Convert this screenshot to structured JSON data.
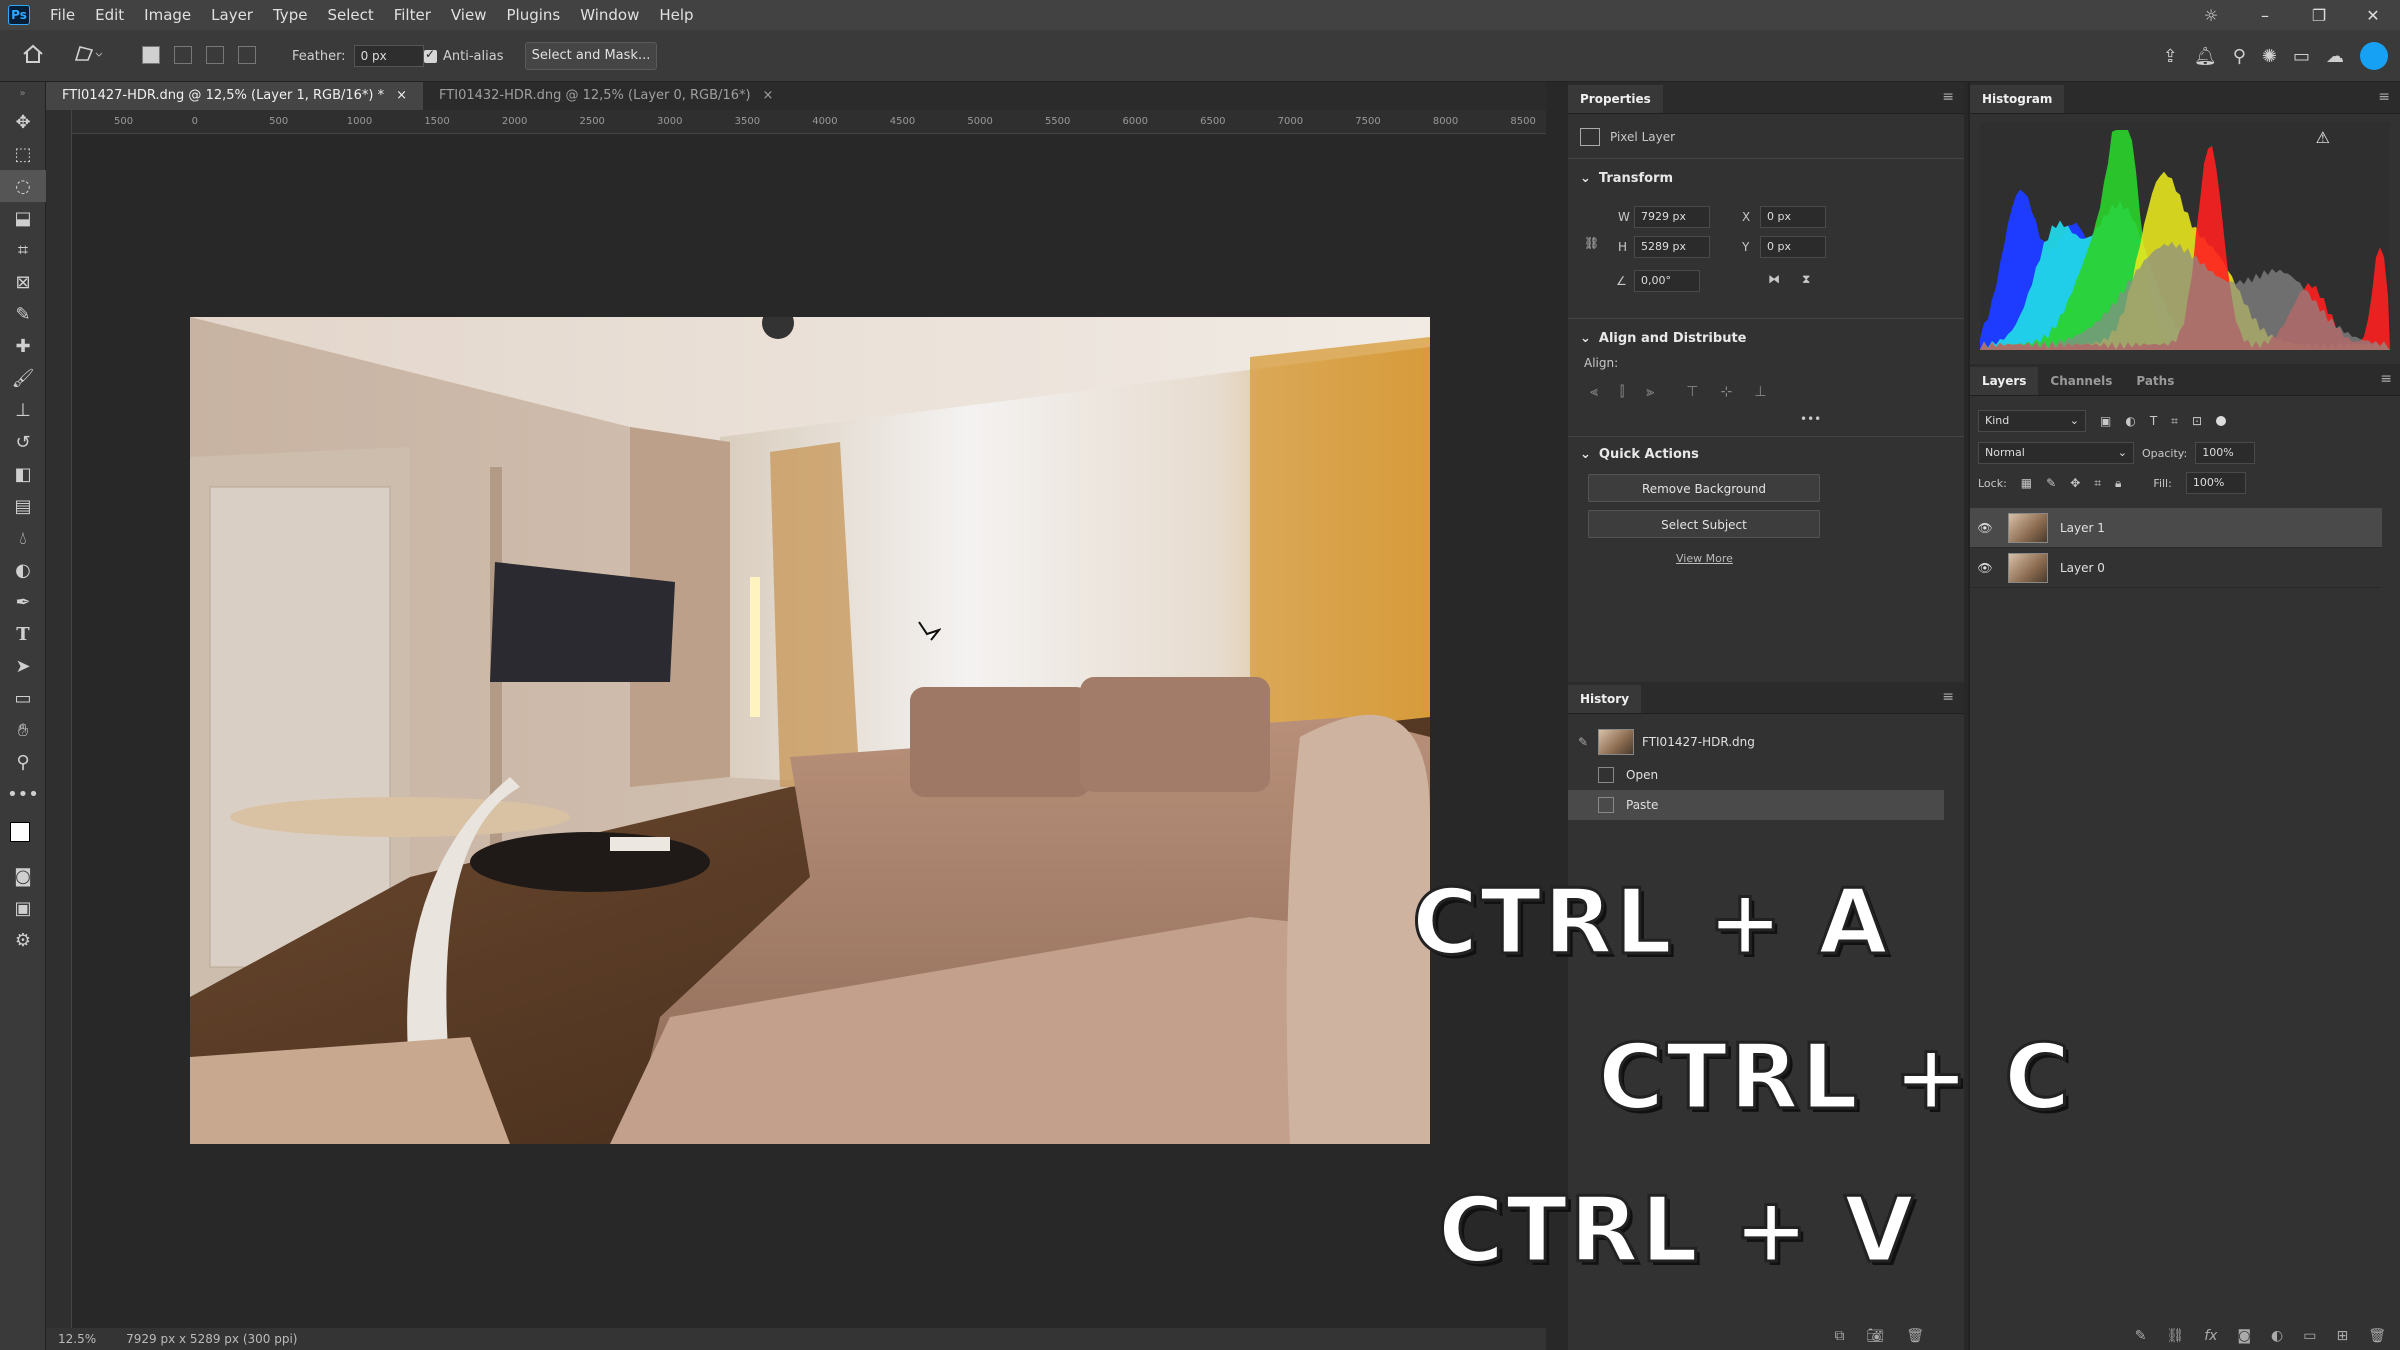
{
  "menubar": {
    "logo": "Ps",
    "items": [
      "File",
      "Edit",
      "Image",
      "Layer",
      "Type",
      "Select",
      "Filter",
      "View",
      "Plugins",
      "Window",
      "Help"
    ]
  },
  "options": {
    "feather_label": "Feather:",
    "feather_value": "0 px",
    "antialias_label": "Anti-alias",
    "select_mask_label": "Select and Mask..."
  },
  "tabs": [
    {
      "label": "FTI01427-HDR.dng @ 12,5% (Layer 1, RGB/16*) *",
      "close": "×"
    },
    {
      "label": "FTI01432-HDR.dng @ 12,5% (Layer 0, RGB/16*)",
      "close": "×"
    }
  ],
  "ruler": {
    "ticks": [
      "500",
      "0",
      "500",
      "1000",
      "1500",
      "2000",
      "2500",
      "3000",
      "3500",
      "4000",
      "4500",
      "5000",
      "5500",
      "6000",
      "6500",
      "7000",
      "7500",
      "8000",
      "8500"
    ]
  },
  "status": {
    "zoom": "12.5%",
    "doc_info": "7929 px x 5289 px (300 ppi)"
  },
  "properties": {
    "tab": "Properties",
    "layer_type": "Pixel Layer",
    "transform_title": "Transform",
    "w_label": "W",
    "w_value": "7929 px",
    "h_label": "H",
    "h_value": "5289 px",
    "x_label": "X",
    "x_value": "0 px",
    "y_label": "Y",
    "y_value": "0 px",
    "angle_value": "0,00°",
    "align_title": "Align and Distribute",
    "align_label": "Align:",
    "more": "•••",
    "qa_title": "Quick Actions",
    "remove_bg": "Remove Background",
    "select_subject": "Select Subject",
    "view_more": "View More"
  },
  "history": {
    "tab": "History",
    "snapshot": "FTI01427-HDR.dng",
    "steps": [
      "Open",
      "Paste"
    ]
  },
  "histogram": {
    "tab": "Histogram",
    "warning_icon": "⚠",
    "colors": {
      "blue": "#1e3cff",
      "cyan": "#22d6e8",
      "green": "#2bd42b",
      "yellow": "#e6e61e",
      "red": "#ff2020",
      "gray": "#8a8a8a"
    }
  },
  "layers": {
    "tabs": [
      "Layers",
      "Channels",
      "Paths"
    ],
    "kind_label": "Kind",
    "blend_mode": "Normal",
    "opacity_label": "Opacity:",
    "opacity_value": "100%",
    "lock_label": "Lock:",
    "fill_label": "Fill:",
    "fill_value": "100%",
    "items": [
      {
        "name": "Layer 1",
        "selected": true
      },
      {
        "name": "Layer 0",
        "selected": false
      }
    ]
  },
  "overlay": {
    "line1": "CTRL + A",
    "line2": "CTRL + C",
    "line3": "CTRL + V"
  }
}
